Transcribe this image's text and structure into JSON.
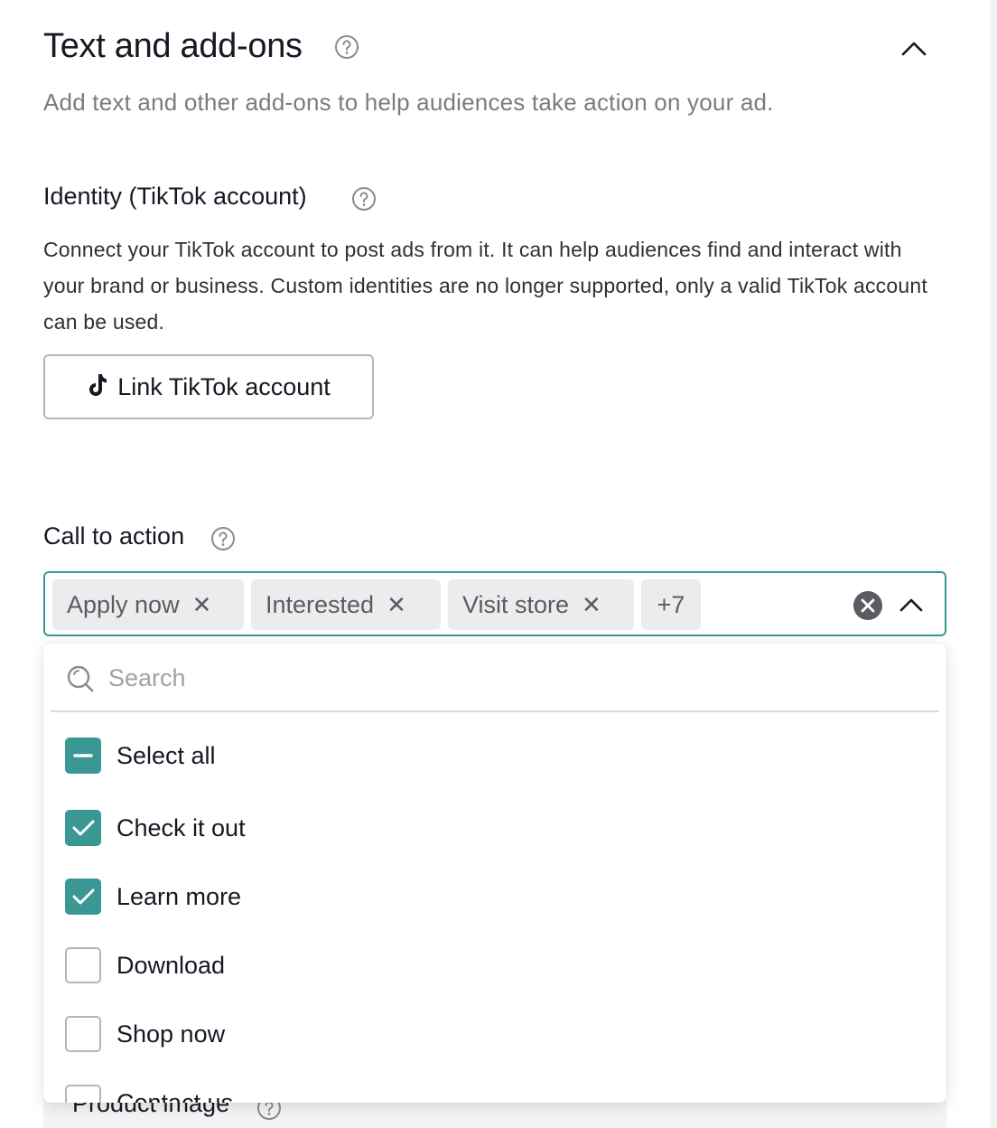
{
  "section": {
    "title": "Text and add-ons",
    "description": "Add text and other add-ons to help audiences take action on your ad."
  },
  "identity": {
    "label": "Identity (TikTok account)",
    "description": "Connect your TikTok account to post ads from it. It can help audiences find and interact with your brand or business. Custom identities are no longer supported, only a valid TikTok account can be used.",
    "link_button": "Link TikTok account"
  },
  "cta": {
    "label": "Call to action",
    "tags": [
      "Apply now",
      "Interested",
      "Visit store"
    ],
    "more_count": "+7",
    "search_placeholder": "Search",
    "options": [
      {
        "label": "Select all",
        "state": "indeterminate"
      },
      {
        "label": "Check it out",
        "state": "checked"
      },
      {
        "label": "Learn more",
        "state": "checked"
      },
      {
        "label": "Download",
        "state": "unchecked"
      },
      {
        "label": "Shop now",
        "state": "unchecked"
      },
      {
        "label": "Contact us",
        "state": "unchecked"
      }
    ]
  },
  "next_section": {
    "label": "Product image"
  },
  "colors": {
    "accent": "#3b9793",
    "text": "#161823",
    "muted": "#7a7b80"
  }
}
